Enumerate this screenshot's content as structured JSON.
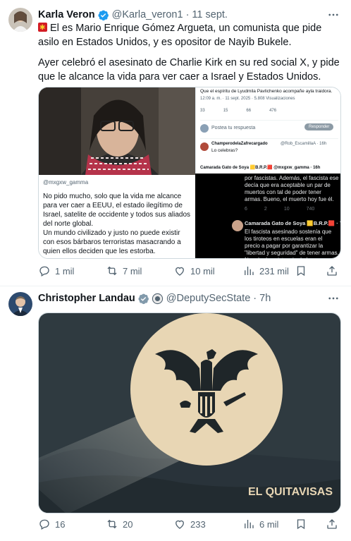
{
  "tweet1": {
    "author_name": "Karla Veron",
    "handle": "@Karla_veron1",
    "date": "· 11 sept.",
    "text_line1": "El es Mario Enrique Gómez Argueta, un comunista que pide asilo en Estados Unidos, y es opositor de Nayib Bukele.",
    "text_line2": "Ayer celebró el asesinato de Charlie Kirk en su red social X, y pide que le alcance la vida para ver caer a Israel y Estados Unidos.",
    "media": {
      "caption_handle": "@mxgxw_gamma",
      "caption_text": "No pido mucho, solo que la vida me alcance para ver caer a EEUU, el estado ilegítimo de Israel, satelite de occidente y todos sus aliados del norte global.\nUn mundo civilizado y justo no puede existir con esos bárbaros terroristas masacrando a quien ellos deciden que les estorba.",
      "shot1_header": "Que el espíritu de Lyudmila Pavlichenko acompañe ayla traidora.",
      "shot1_meta": "12:09 a. m. · 11 sept. 2025 · 5.808 Visualizaciones",
      "shot1_counts": [
        "33",
        "15",
        "66",
        "476"
      ],
      "shot1_reply_prompt": "Postea tu respuesta",
      "shot1_reply_button": "Responder",
      "shot1_reply_user": "ChamperodelaZafrecargado",
      "shot1_reply_handle": "@Rob_EscamillaA · 16h",
      "shot1_reply_text": "Lo celebras?",
      "shot1_reply2": "Camarada Gato de Soya 🟨B.R.P.🟥 @mxgxw_gamma · 16h",
      "shot2_text1": "por fascistas. Además, el fascista ese decía que era aceptable un par de muertos con tal de poder tener armas. Bueno, el muerto hoy fue él.",
      "shot2_counts": [
        "6",
        "2",
        "10",
        "740"
      ],
      "shot2_user": "Camarada Gato de Soya 🟨B.R.P.🟥 · 7h",
      "shot2_text2": "El fascista asesinado sostenía que los tiroteos en escuelas eran el precio a pagar por garantizar la \"libertad y seguridad\" de tener armas. Negaba la existencia de los palestinos. Ah, pero hoy"
    },
    "stats": {
      "replies": "1 mil",
      "reposts": "7 mil",
      "likes": "10 mil",
      "views": "231 mil"
    }
  },
  "tweet2": {
    "author_name": "Christopher Landau",
    "handle": "@DeputySecState · 7h",
    "media": {
      "title": "EL QUITAVISAS"
    },
    "stats": {
      "replies": "16",
      "reposts": "20",
      "likes": "233",
      "views": "6 mil"
    }
  },
  "colors": {
    "verified": "#1d9bf0",
    "gray_text": "#536471",
    "poster_bg": "#2f3a40",
    "moon": "#e8d6b4"
  }
}
